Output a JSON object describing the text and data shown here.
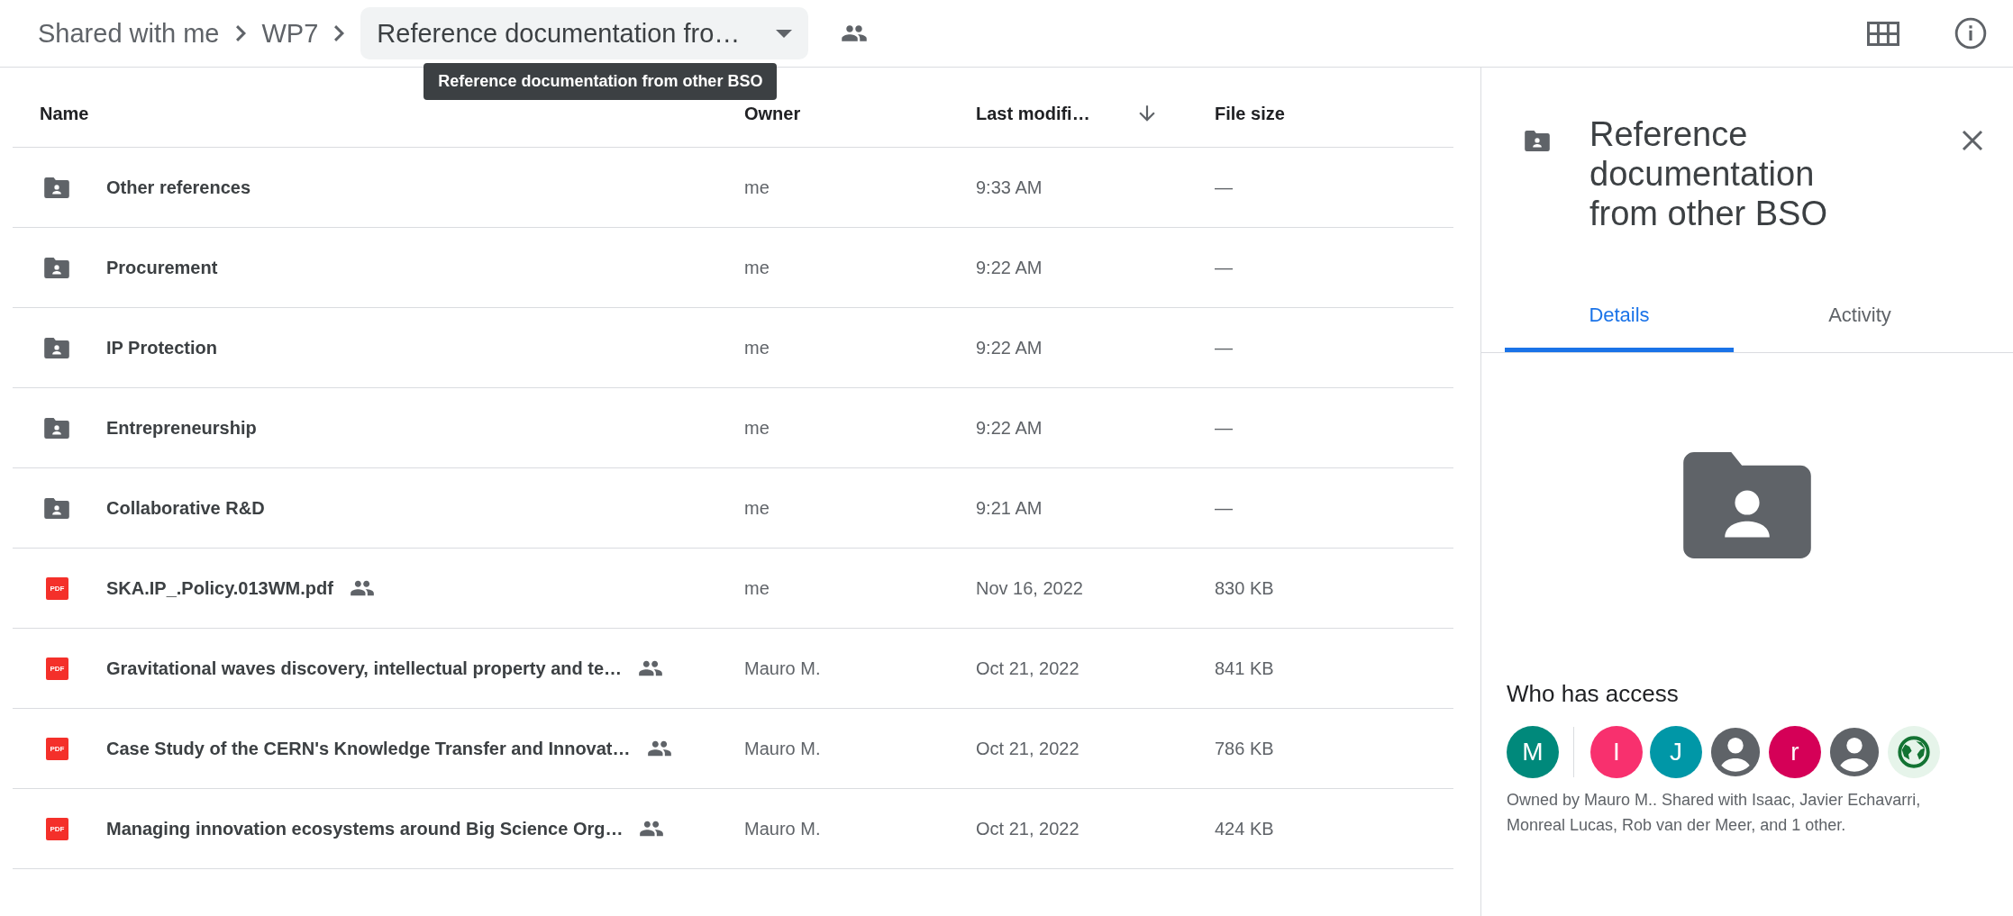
{
  "breadcrumb": {
    "items": [
      {
        "label": "Shared with me"
      },
      {
        "label": "WP7"
      }
    ],
    "current": {
      "label": "Reference documentation fro…",
      "tooltip": "Reference documentation from other BSO"
    }
  },
  "table": {
    "columns": [
      {
        "label": "Name",
        "sorted": false
      },
      {
        "label": "Owner",
        "sorted": false
      },
      {
        "label": "Last modifi…",
        "sorted": true
      },
      {
        "label": "File size",
        "sorted": false
      }
    ],
    "rows": [
      {
        "kind": "folder",
        "name": "Other references",
        "shared": false,
        "owner": "me",
        "modified": "9:33 AM",
        "size": "—"
      },
      {
        "kind": "folder",
        "name": "Procurement",
        "shared": false,
        "owner": "me",
        "modified": "9:22 AM",
        "size": "—"
      },
      {
        "kind": "folder",
        "name": "IP Protection",
        "shared": false,
        "owner": "me",
        "modified": "9:22 AM",
        "size": "—"
      },
      {
        "kind": "folder",
        "name": "Entrepreneurship",
        "shared": false,
        "owner": "me",
        "modified": "9:22 AM",
        "size": "—"
      },
      {
        "kind": "folder",
        "name": "Collaborative R&D",
        "shared": false,
        "owner": "me",
        "modified": "9:21 AM",
        "size": "—"
      },
      {
        "kind": "pdf",
        "badge": "PDF",
        "name": "SKA.IP_.Policy.013WM.pdf",
        "shared": true,
        "owner": "me",
        "modified": "Nov 16, 2022",
        "size": "830 KB"
      },
      {
        "kind": "pdf",
        "badge": "PDF",
        "name": "Gravitational waves discovery, intellectual property and te…",
        "shared": true,
        "owner": "Mauro M.",
        "modified": "Oct 21, 2022",
        "size": "841 KB"
      },
      {
        "kind": "pdf",
        "badge": "PDF",
        "name": "Case Study of the CERN's Knowledge Transfer and Innovat…",
        "shared": true,
        "owner": "Mauro M.",
        "modified": "Oct 21, 2022",
        "size": "786 KB"
      },
      {
        "kind": "pdf",
        "badge": "PDF",
        "name": "Managing innovation ecosystems around Big Science Org…",
        "shared": true,
        "owner": "Mauro M.",
        "modified": "Oct 21, 2022",
        "size": "424 KB"
      }
    ]
  },
  "details": {
    "title": "Reference documentation from other BSO",
    "tabs": [
      {
        "label": "Details",
        "selected": true
      },
      {
        "label": "Activity",
        "selected": false
      }
    ],
    "access_heading": "Who has access",
    "avatars": [
      {
        "kind": "letter",
        "letter": "M",
        "color": "#00897b"
      },
      {
        "kind": "letter",
        "letter": "I",
        "color": "#f8306e"
      },
      {
        "kind": "letter",
        "letter": "J",
        "color": "#0097a7"
      },
      {
        "kind": "person",
        "color": "#5f6368"
      },
      {
        "kind": "letter",
        "letter": "r",
        "color": "#d50057"
      },
      {
        "kind": "person",
        "color": "#5f6368"
      },
      {
        "kind": "globe",
        "color": "#137333"
      }
    ],
    "access_text": "Owned by Mauro M.. Shared with Isaac, Javier Echavarri, Monreal Lucas, Rob van der Meer, and 1 other."
  }
}
